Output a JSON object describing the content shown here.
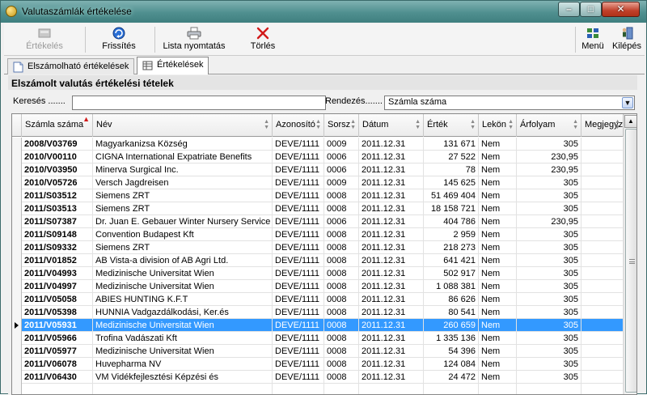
{
  "window": {
    "title": "Valutaszámlák értékelése",
    "buttons": {
      "minimize": "–",
      "maximize": "□",
      "close": "✕"
    }
  },
  "toolbar": {
    "evaluate": "Értékelés",
    "refresh": "Frissítés",
    "print_list": "Lista nyomtatás",
    "delete": "Törlés",
    "menu": "Menü",
    "exit": "Kilépés"
  },
  "tabs": [
    {
      "label": "Elszámolható értékelések",
      "icon": "document-icon"
    },
    {
      "label": "Értékelések",
      "icon": "table-icon"
    }
  ],
  "panel": {
    "title": "Elszámolt valutás értékelési tételek",
    "search_label": "Keresés .......",
    "search_value": "",
    "sort_label": "Rendezés.......",
    "sort_value": "Számla száma"
  },
  "columns": [
    "Számla száma",
    "Név",
    "Azonosító",
    "Sorsz",
    "Dátum",
    "Érték",
    "Lekön",
    "Árfolyam",
    "Megjegyz"
  ],
  "rows": [
    {
      "acct": "2008/V03769",
      "name": "Magyarkanizsa Község",
      "id": "DEVE/1111",
      "seq": "0009",
      "date": "2011.12.31",
      "value": "131 671",
      "lek": "Nem",
      "rate": "305",
      "note": ""
    },
    {
      "acct": "2010/V00110",
      "name": "CIGNA International Expatriate Benefits",
      "id": "DEVE/1111",
      "seq": "0006",
      "date": "2011.12.31",
      "value": "27 522",
      "lek": "Nem",
      "rate": "230,95",
      "note": ""
    },
    {
      "acct": "2010/V03950",
      "name": "Minerva Surgical Inc.",
      "id": "DEVE/1111",
      "seq": "0006",
      "date": "2011.12.31",
      "value": "78",
      "lek": "Nem",
      "rate": "230,95",
      "note": ""
    },
    {
      "acct": "2010/V05726",
      "name": "Versch Jagdreisen",
      "id": "DEVE/1111",
      "seq": "0009",
      "date": "2011.12.31",
      "value": "145 625",
      "lek": "Nem",
      "rate": "305",
      "note": ""
    },
    {
      "acct": "2011/S03512",
      "name": "Siemens ZRT",
      "id": "DEVE/1111",
      "seq": "0008",
      "date": "2011.12.31",
      "value": "51 469 404",
      "lek": "Nem",
      "rate": "305",
      "note": ""
    },
    {
      "acct": "2011/S03513",
      "name": "Siemens ZRT",
      "id": "DEVE/1111",
      "seq": "0008",
      "date": "2011.12.31",
      "value": "18 158 721",
      "lek": "Nem",
      "rate": "305",
      "note": ""
    },
    {
      "acct": "2011/S07387",
      "name": "Dr. Juan E. Gebauer Winter Nursery Service",
      "id": "DEVE/1111",
      "seq": "0006",
      "date": "2011.12.31",
      "value": "404 786",
      "lek": "Nem",
      "rate": "230,95",
      "note": ""
    },
    {
      "acct": "2011/S09148",
      "name": "Convention Budapest Kft",
      "id": "DEVE/1111",
      "seq": "0008",
      "date": "2011.12.31",
      "value": "2 959",
      "lek": "Nem",
      "rate": "305",
      "note": ""
    },
    {
      "acct": "2011/S09332",
      "name": "Siemens ZRT",
      "id": "DEVE/1111",
      "seq": "0008",
      "date": "2011.12.31",
      "value": "218 273",
      "lek": "Nem",
      "rate": "305",
      "note": ""
    },
    {
      "acct": "2011/V01852",
      "name": "AB Vista-a division of AB Agri Ltd.",
      "id": "DEVE/1111",
      "seq": "0008",
      "date": "2011.12.31",
      "value": "641 421",
      "lek": "Nem",
      "rate": "305",
      "note": ""
    },
    {
      "acct": "2011/V04993",
      "name": "Medizinische Universitat Wien",
      "id": "DEVE/1111",
      "seq": "0008",
      "date": "2011.12.31",
      "value": "502 917",
      "lek": "Nem",
      "rate": "305",
      "note": ""
    },
    {
      "acct": "2011/V04997",
      "name": "Medizinische Universitat Wien",
      "id": "DEVE/1111",
      "seq": "0008",
      "date": "2011.12.31",
      "value": "1 088 381",
      "lek": "Nem",
      "rate": "305",
      "note": ""
    },
    {
      "acct": "2011/V05058",
      "name": "ABIES HUNTING K.F.T",
      "id": "DEVE/1111",
      "seq": "0008",
      "date": "2011.12.31",
      "value": "86 626",
      "lek": "Nem",
      "rate": "305",
      "note": ""
    },
    {
      "acct": "2011/V05398",
      "name": "HUNNIA Vadgazdálkodási, Ker.és",
      "id": "DEVE/1111",
      "seq": "0008",
      "date": "2011.12.31",
      "value": "80 541",
      "lek": "Nem",
      "rate": "305",
      "note": ""
    },
    {
      "acct": "2011/V05931",
      "name": "Medizinische Universitat Wien",
      "id": "DEVE/1111",
      "seq": "0008",
      "date": "2011.12.31",
      "value": "260 659",
      "lek": "Nem",
      "rate": "305",
      "note": "",
      "selected": true
    },
    {
      "acct": "2011/V05966",
      "name": "Trofina Vadászati Kft",
      "id": "DEVE/1111",
      "seq": "0008",
      "date": "2011.12.31",
      "value": "1 335 136",
      "lek": "Nem",
      "rate": "305",
      "note": ""
    },
    {
      "acct": "2011/V05977",
      "name": "Medizinische Universitat Wien",
      "id": "DEVE/1111",
      "seq": "0008",
      "date": "2011.12.31",
      "value": "54 396",
      "lek": "Nem",
      "rate": "305",
      "note": ""
    },
    {
      "acct": "2011/V06078",
      "name": "Huvepharma NV",
      "id": "DEVE/1111",
      "seq": "0008",
      "date": "2011.12.31",
      "value": "124 084",
      "lek": "Nem",
      "rate": "305",
      "note": ""
    },
    {
      "acct": "2011/V06430",
      "name": "VM Vidékfejlesztési Képzési és",
      "id": "DEVE/1111",
      "seq": "0008",
      "date": "2011.12.31",
      "value": "24 472",
      "lek": "Nem",
      "rate": "305",
      "note": ""
    },
    {
      "acct": "",
      "name": "",
      "id": "",
      "seq": "",
      "date": "",
      "value": "",
      "lek": "",
      "rate": "",
      "note": ""
    }
  ],
  "colors": {
    "selection": "#3399ff",
    "titlebar": "#4f8f8f",
    "sort_arrow": "#d21a1a",
    "delete_icon": "#d21a1a"
  }
}
